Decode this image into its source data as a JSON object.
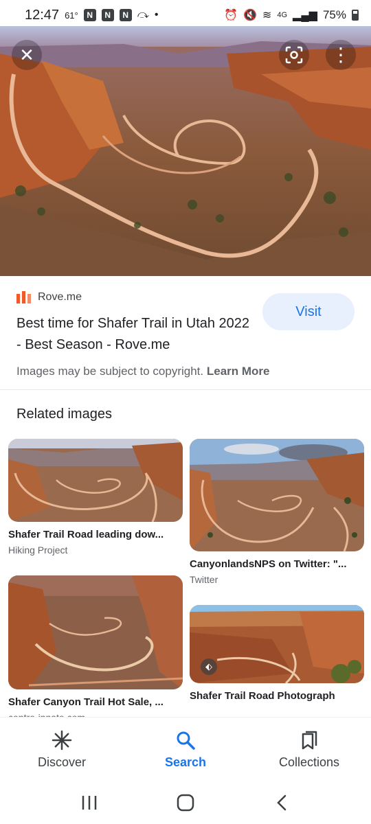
{
  "status_bar": {
    "time": "12:47",
    "temperature": "61°",
    "network": "4G",
    "battery": "75%"
  },
  "hero": {
    "close_icon": "close-icon",
    "lens_icon": "lens-icon",
    "more_icon": "more-vert-icon"
  },
  "result": {
    "source_name": "Rove.me",
    "title": "Best time for Shafer Trail in Utah 2022 - Best Season - Rove.me",
    "visit_label": "Visit",
    "copyright_text": "Images may be subject to copyright.",
    "learn_more_label": "Learn More"
  },
  "related": {
    "heading": "Related images",
    "items": [
      {
        "title": "Shafer Trail Road leading dow...",
        "source": "Hiking Project"
      },
      {
        "title": "CanyonlandsNPS on Twitter: \"...",
        "source": "Twitter"
      },
      {
        "title": "Shafer Canyon Trail Hot Sale, ...",
        "source": "centro-innate.com"
      },
      {
        "title": "Shafer Trail Road Photograph",
        "source": ""
      }
    ]
  },
  "bottom_nav": {
    "items": [
      {
        "label": "Discover",
        "icon": "asterisk-icon"
      },
      {
        "label": "Search",
        "icon": "search-icon"
      },
      {
        "label": "Collections",
        "icon": "bookmarks-icon"
      }
    ]
  },
  "colors": {
    "accent": "#1a73e8",
    "visit_bg": "#e8f0fe",
    "source_logo": "#f1592a"
  }
}
